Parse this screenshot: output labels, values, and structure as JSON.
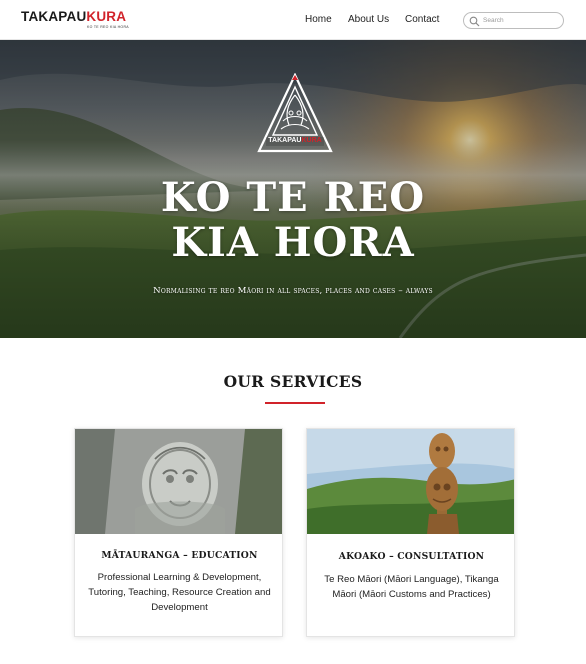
{
  "header": {
    "logo": {
      "part_a": "TAKAPAU",
      "part_b": "KURA",
      "subtitle": "KO TE REO KIA HORA"
    },
    "nav": [
      {
        "label": "Home"
      },
      {
        "label": "About Us"
      },
      {
        "label": "Contact"
      }
    ],
    "search": {
      "placeholder": "Search",
      "value": ""
    }
  },
  "hero": {
    "emblem_text": {
      "part_a": "TAKAPAU",
      "part_b": "KURA"
    },
    "title_line1": "KO TE REO",
    "title_line2": "KIA HORA",
    "tagline": "Normalising te reo Māori in all spaces, places and cases – always"
  },
  "services": {
    "heading": "OUR SERVICES",
    "cards": [
      {
        "title": "MĀTAURANGA – EDUCATION",
        "text": "Professional Learning & Development, Tutoring, Teaching, Resource Creation and Development",
        "image": "carved-rock-face"
      },
      {
        "title": "AKOAKO – CONSULTATION",
        "text": "Te Reo Māori (Māori Language), Tikanga Māori (Māori Customs and Practices)",
        "image": "carved-wooden-statue"
      }
    ]
  },
  "colors": {
    "accent": "#d1232a",
    "text": "#1a1a1a",
    "hero_text": "#ffffff"
  }
}
